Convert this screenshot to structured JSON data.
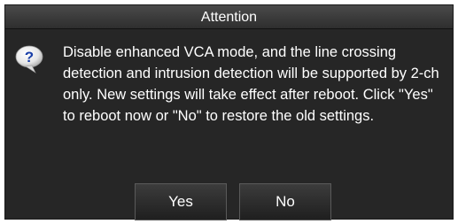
{
  "dialog": {
    "title": "Attention",
    "icon": "question-bubble-icon",
    "message": "Disable enhanced VCA mode, and the line crossing detection and intrusion detection will be supported by 2-ch only. New settings will take effect after reboot. Click \"Yes\" to reboot now or \"No\" to restore the old settings.",
    "buttons": {
      "yes_label": "Yes",
      "no_label": "No"
    }
  },
  "colors": {
    "background": "#262626",
    "title_bar": "#3a3a3a",
    "text": "#ffffff",
    "icon_blue": "#1a3fa8"
  }
}
